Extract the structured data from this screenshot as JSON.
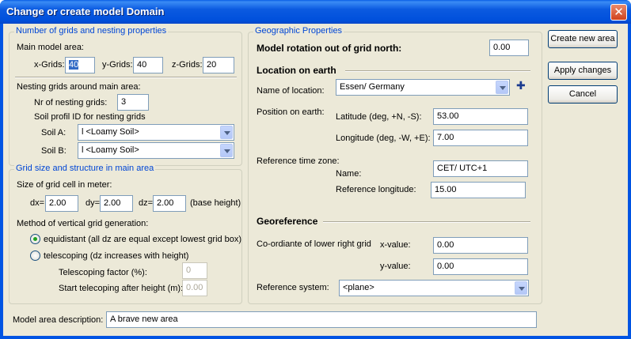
{
  "window": {
    "title": "Change or create model Domain",
    "close_label": "✕"
  },
  "grids_group": {
    "title": "Number of grids and nesting properties",
    "main_area_label": "Main model area:",
    "xgrids_label": "x-Grids:",
    "xgrids_value": "40",
    "ygrids_label": "y-Grids:",
    "ygrids_value": "40",
    "zgrids_label": "z-Grids:",
    "zgrids_value": "20",
    "nesting_label": "Nesting grids around main area:",
    "nr_nesting_label": "Nr of nesting grids:",
    "nr_nesting_value": "3",
    "soil_profil_label": "Soil profil ID for nesting grids",
    "soil_a_label": "Soil A:",
    "soil_a_value": "l <Loamy Soil>",
    "soil_b_label": "Soil B:",
    "soil_b_value": "l <Loamy Soil>"
  },
  "structure_group": {
    "title": "Grid size and structure in main area",
    "cell_size_label": "Size of grid cell in meter:",
    "dx_label": "dx=",
    "dx_value": "2.00",
    "dy_label": "dy=",
    "dy_value": "2.00",
    "dz_label": "dz=",
    "dz_value": "2.00",
    "base_height_label": "(base height)",
    "method_label": "Method of vertical grid generation:",
    "equidistant_label": "equidistant (all dz are equal except lowest grid box)",
    "telescoping_label": "telescoping (dz increases with height)",
    "tele_factor_label": "Telescoping factor (%):",
    "tele_factor_value": "0",
    "start_tele_label": "Start telecoping after height (m):",
    "start_tele_value": "0.00"
  },
  "geo_group": {
    "title": "Geographic Properties",
    "rotation_label": "Model rotation out of grid north:",
    "rotation_value": "0.00",
    "location_heading": "Location on earth",
    "name_location_label": "Name of location:",
    "name_location_value": "Essen/ Germany",
    "add_label": "✚",
    "position_label": "Position on earth:",
    "latitude_label": "Latitude (deg, +N, -S):",
    "latitude_value": "53.00",
    "longitude_label": "Longitude (deg, -W, +E):",
    "longitude_value": "7.00",
    "ref_time_label": "Reference time zone:",
    "tz_name_label": "Name:",
    "tz_name_value": "CET/ UTC+1",
    "ref_long_label": "Reference longitude:",
    "ref_long_value": "15.00",
    "georef_heading": "Georeference",
    "coord_label": "Co-ordiante of lower right grid",
    "xvalue_label": "x-value:",
    "xvalue_value": "0.00",
    "yvalue_label": "y-value:",
    "yvalue_value": "0.00",
    "ref_system_label": "Reference system:",
    "ref_system_value": "<plane>"
  },
  "buttons": {
    "create_new_area": "Create new area",
    "apply_changes": "Apply changes",
    "cancel": "Cancel"
  },
  "description": {
    "label": "Model area description:",
    "value": "A brave new area"
  }
}
